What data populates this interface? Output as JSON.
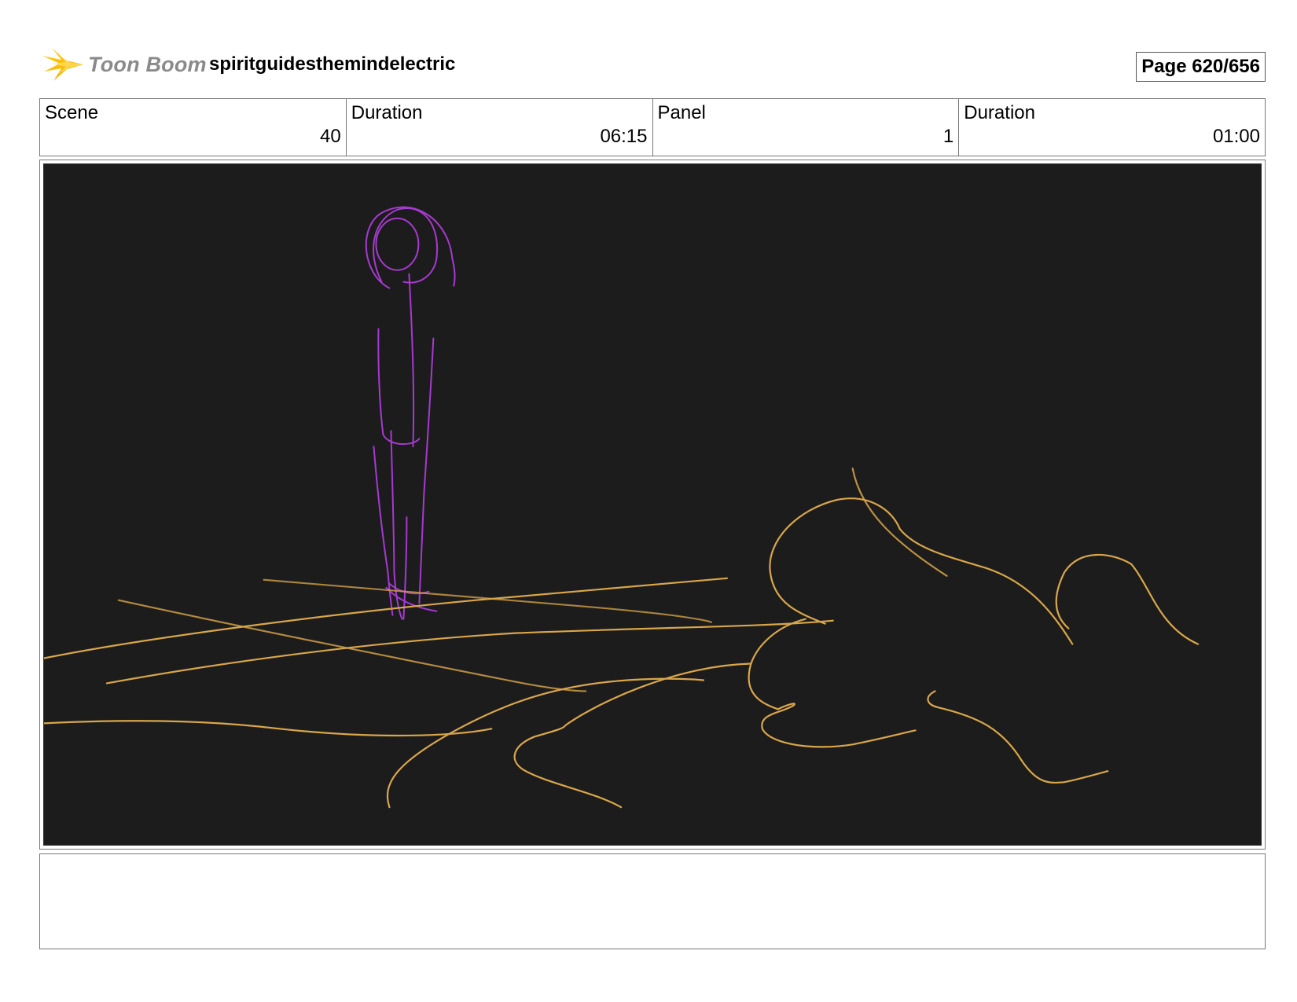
{
  "header": {
    "logo_text": "Toon Boom",
    "project_title": "spiritguidesthemindelectric",
    "page_label": "Page 620/656"
  },
  "info": [
    {
      "label": "Scene",
      "value": "40"
    },
    {
      "label": "Duration",
      "value": "06:15"
    },
    {
      "label": "Panel",
      "value": "1"
    },
    {
      "label": "Duration",
      "value": "01:00"
    }
  ],
  "panel": {
    "background_color": "#1c1c1c",
    "figure_color": "#a63ad0",
    "landscape_color": "#d9a64a"
  },
  "notes": {
    "text": ""
  }
}
